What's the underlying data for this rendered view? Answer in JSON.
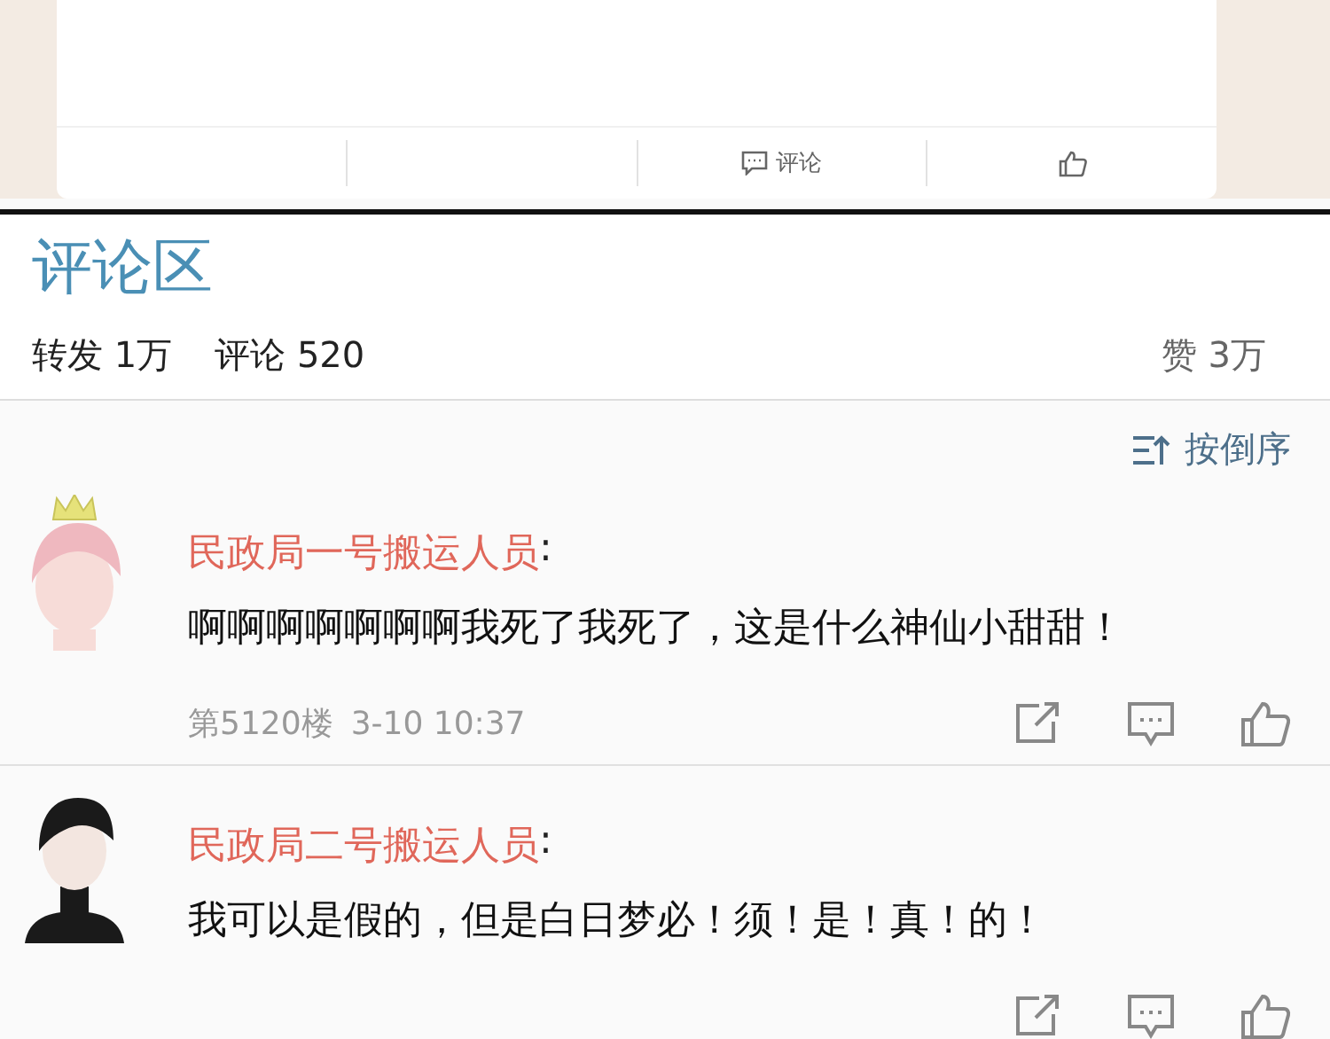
{
  "post_actions": [
    {
      "kind": "comment",
      "label": "评论"
    },
    {
      "kind": "like"
    }
  ],
  "section_title": "评论区",
  "stats": {
    "reposts_label": "转发",
    "reposts": "1万",
    "comments_label": "评论",
    "comments": "520",
    "likes_label": "赞",
    "likes": "3万"
  },
  "sort": {
    "label": "按倒序"
  },
  "comments": [
    {
      "author": "民政局一号搬运人员",
      "colon": ":",
      "kind": "crowned",
      "text": "啊啊啊啊啊啊啊我死了我死了，这是什么神仙小甜甜！",
      "floor": "第5120楼",
      "time": "3-10 10:37"
    },
    {
      "author": "民政局二号搬运人员",
      "colon": ":",
      "kind": "dark",
      "text": "我可以是假的，但是白日梦必！须！是！真！的！"
    }
  ]
}
